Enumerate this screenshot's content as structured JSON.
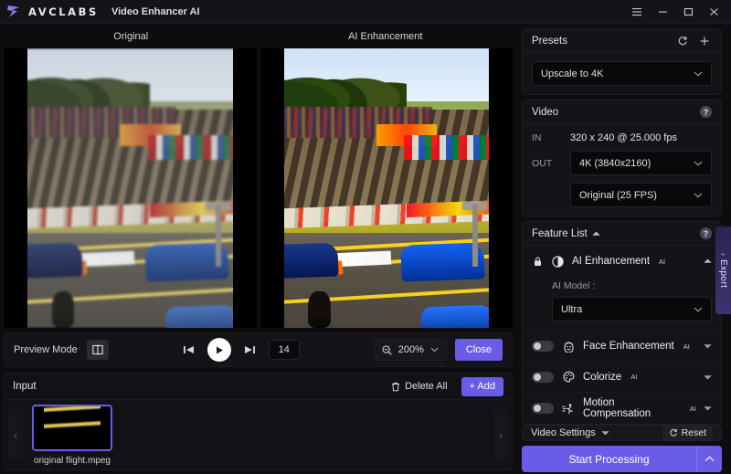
{
  "titlebar": {
    "brand": "AVCLABS",
    "app_title": "Video Enhancer AI",
    "menu_icon": "hamburger-icon",
    "minimize_label": "–",
    "maximize_label": "□",
    "close_label": "✕"
  },
  "preview": {
    "left_label": "Original",
    "right_label": "AI Enhancement"
  },
  "toolbar": {
    "preview_mode_label": "Preview Mode",
    "split_view_icon": "split-view-icon",
    "prev_frame_icon": "previous-frame-icon",
    "play_icon": "play-icon",
    "next_frame_icon": "next-frame-icon",
    "frame_number": "14",
    "zoom_icon": "zoom-icon",
    "zoom_value": "200%",
    "close_label": "Close"
  },
  "input": {
    "title": "Input",
    "delete_all_label": "Delete All",
    "add_label": "+ Add",
    "prev_arrow": "‹",
    "next_arrow": "›",
    "items": [
      {
        "name": "original flight.mpeg"
      }
    ]
  },
  "presets": {
    "title": "Presets",
    "refresh_icon": "refresh-icon",
    "add_icon": "plus-icon",
    "selected": "Upscale to 4K"
  },
  "video": {
    "title": "Video",
    "help_label": "?",
    "in_label": "IN",
    "in_value": "320 x 240 @ 25.000 fps",
    "out_label": "OUT",
    "resolution": "4K (3840x2160)",
    "framerate": "Original (25 FPS)"
  },
  "feature_list": {
    "title": "Feature List",
    "help_label": "?",
    "items": [
      {
        "name": "AI Enhancement",
        "badge": "AI",
        "icon": "contrast-icon",
        "locked": true,
        "expanded": true,
        "model_label": "AI Model :",
        "model_value": "Ultra"
      },
      {
        "name": "Face Enhancement",
        "badge": "AI",
        "icon": "face-icon",
        "enabled": false
      },
      {
        "name": "Colorize",
        "badge": "AI",
        "icon": "palette-icon",
        "enabled": false
      },
      {
        "name": "Motion Compensation",
        "badge": "AI",
        "icon": "motion-icon",
        "enabled": false
      }
    ]
  },
  "footer": {
    "video_settings_label": "Video Settings",
    "reset_label": "Reset",
    "start_label": "Start Processing",
    "start_caret_icon": "chevron-up-icon"
  },
  "export_tab": {
    "label": "Export",
    "chevron": "›"
  },
  "colors": {
    "accent": "#6b5ce7",
    "panel": "#141418",
    "background": "#0d0d10"
  }
}
